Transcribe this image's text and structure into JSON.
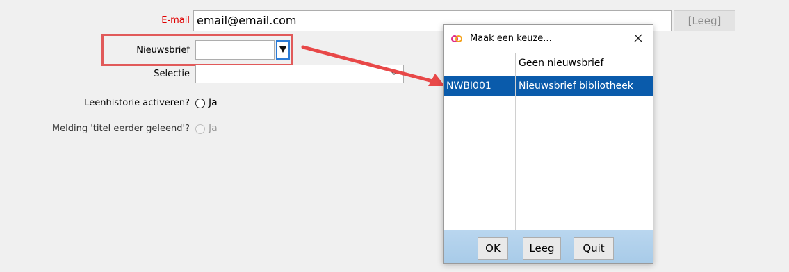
{
  "form": {
    "email_label": "E-mail",
    "email_value": "email@email.com",
    "leeg_button": "[Leeg]",
    "nieuwsbrief_label": "Nieuwsbrief",
    "nieuwsbrief_value": "",
    "selectie_label": "Selectie",
    "selectie_value": "",
    "leenhistorie_label": "Leenhistorie activeren?",
    "leenhistorie_option": "Ja",
    "melding_label": "Melding 'titel eerder geleend'?",
    "melding_option": "Ja"
  },
  "dialog": {
    "title": "Maak een keuze...",
    "rows": [
      {
        "code": "",
        "name": "Geen nieuwsbrief",
        "selected": false
      },
      {
        "code": "NWBI001",
        "name": "Nieuwsbrief bibliotheek",
        "selected": true
      }
    ],
    "buttons": {
      "ok": "OK",
      "leeg": "Leeg",
      "quit": "Quit"
    }
  },
  "colors": {
    "required_label": "#e00000",
    "selection": "#0a5bab",
    "highlight": "#e15a5a",
    "footer": "#b9d6ef"
  }
}
